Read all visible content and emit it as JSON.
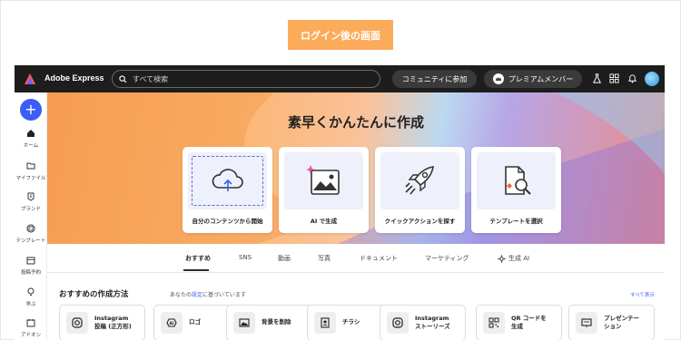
{
  "banner": {
    "text": "ログイン後の画面"
  },
  "topbar": {
    "app_name": "Adobe Express",
    "search_placeholder": "すべて検索",
    "community_label": "コミュニティに参加",
    "premium_label": "プレミアムメンバー",
    "icons": [
      "labs-icon",
      "apps-grid-icon",
      "bell-icon",
      "avatar"
    ]
  },
  "sidebar": {
    "create_label": "+",
    "items": [
      {
        "label": "ホーム",
        "icon": "home-icon"
      },
      {
        "label": "マイファイル",
        "icon": "folder-icon"
      },
      {
        "label": "ブランド",
        "icon": "brand-icon"
      },
      {
        "label": "テンプレート",
        "icon": "template-icon"
      },
      {
        "label": "投稿予約",
        "icon": "calendar-icon"
      },
      {
        "label": "学ぶ",
        "icon": "lightbulb-icon"
      },
      {
        "label": "アドオン",
        "icon": "addon-icon"
      }
    ]
  },
  "hero": {
    "title": "素早くかんたんに作成",
    "cards": [
      {
        "label": "自分のコンテンツから開始",
        "icon": "cloud-upload-icon"
      },
      {
        "label": "AI で生成",
        "icon": "ai-image-icon"
      },
      {
        "label": "クイックアクションを探す",
        "icon": "rocket-icon"
      },
      {
        "label": "テンプレートを選択",
        "icon": "template-search-icon"
      }
    ]
  },
  "tabs": [
    {
      "label": "おすすめ",
      "active": true
    },
    {
      "label": "SNS"
    },
    {
      "label": "動画"
    },
    {
      "label": "写真"
    },
    {
      "label": "ドキュメント"
    },
    {
      "label": "マーケティング"
    },
    {
      "label": "生成 AI",
      "icon": "sparkle-icon"
    }
  ],
  "recommended": {
    "title": "おすすめの作成方法",
    "subtitle_prefix": "あなたの",
    "subtitle_link": "設定",
    "subtitle_suffix": "に基づいています",
    "see_all": "すべて表示",
    "items": [
      {
        "label": "Instagram\n投稿 (正方形)",
        "icon": "instagram-icon"
      },
      {
        "label": "ロゴ",
        "icon": "logo-ai-icon"
      },
      {
        "label": "背景を削除",
        "icon": "remove-bg-icon"
      },
      {
        "label": "チラシ",
        "icon": "flyer-icon"
      },
      {
        "label": "Instagram\nストーリーズ",
        "icon": "instagram-icon"
      },
      {
        "label": "QR コードを\n生成",
        "icon": "qr-code-icon"
      },
      {
        "label": "プレゼンテー\nション",
        "icon": "presentation-icon"
      }
    ]
  },
  "colors": {
    "accent": "#3b5cf6",
    "banner": "#fcab5b",
    "topbar": "#1d1d1d"
  }
}
